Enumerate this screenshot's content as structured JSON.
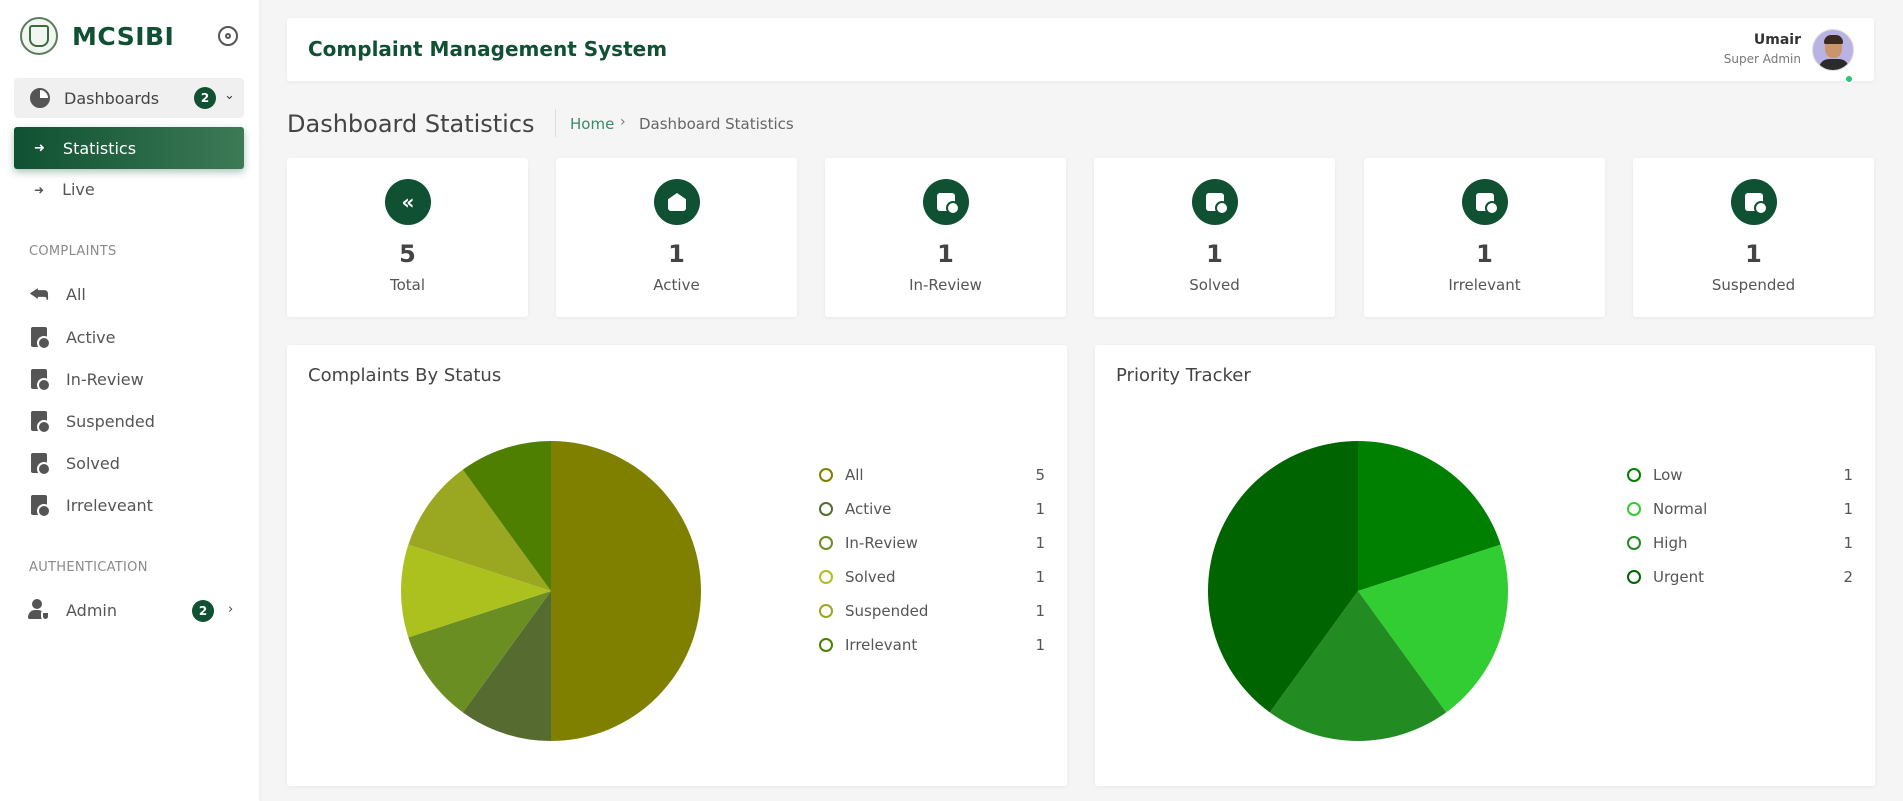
{
  "brand": {
    "name": "MCSIBI"
  },
  "sidebar": {
    "dashboards": {
      "label": "Dashboards",
      "badge": "2"
    },
    "statistics": {
      "label": "Statistics"
    },
    "live": {
      "label": "Live"
    },
    "complaints_section": "COMPLAINTS",
    "complaints": [
      {
        "label": "All",
        "icon": "reply-all-icon"
      },
      {
        "label": "Active",
        "icon": "document-shield-icon"
      },
      {
        "label": "In-Review",
        "icon": "document-chart-icon"
      },
      {
        "label": "Suspended",
        "icon": "document-minus-icon"
      },
      {
        "label": "Solved",
        "icon": "document-check-icon"
      },
      {
        "label": "Irreleveant",
        "icon": "document-alert-icon"
      }
    ],
    "auth_section": "AUTHENTICATION",
    "admin": {
      "label": "Admin",
      "badge": "2"
    }
  },
  "header": {
    "title": "Complaint Management System",
    "user_name": "Umair",
    "user_role": "Super Admin"
  },
  "page": {
    "title": "Dashboard Statistics",
    "breadcrumb_home": "Home",
    "breadcrumb_current": "Dashboard Statistics"
  },
  "stats": [
    {
      "value": "5",
      "label": "Total",
      "icon": "reply-all-icon"
    },
    {
      "value": "1",
      "label": "Active",
      "icon": "envelope-open-icon"
    },
    {
      "value": "1",
      "label": "In-Review",
      "icon": "document-edit-icon"
    },
    {
      "value": "1",
      "label": "Solved",
      "icon": "document-check-icon"
    },
    {
      "value": "1",
      "label": "Irrelevant",
      "icon": "document-alert-icon"
    },
    {
      "value": "1",
      "label": "Suspended",
      "icon": "document-minus-icon"
    }
  ],
  "chart_data": [
    {
      "type": "pie",
      "title": "Complaints By Status",
      "categories": [
        "All",
        "Active",
        "In-Review",
        "Solved",
        "Suspended",
        "Irrelevant"
      ],
      "values": [
        5,
        1,
        1,
        1,
        1,
        1
      ],
      "colors": [
        "#808000",
        "#556b2f",
        "#6b8e23",
        "#adc11e",
        "#9aa720",
        "#4f7f00"
      ],
      "legend": "right"
    },
    {
      "type": "pie",
      "title": "Priority Tracker",
      "categories": [
        "Low",
        "Normal",
        "High",
        "Urgent"
      ],
      "values": [
        1,
        1,
        1,
        2
      ],
      "colors": [
        "#008000",
        "#32cd32",
        "#228b22",
        "#006400"
      ],
      "legend": "right"
    }
  ]
}
